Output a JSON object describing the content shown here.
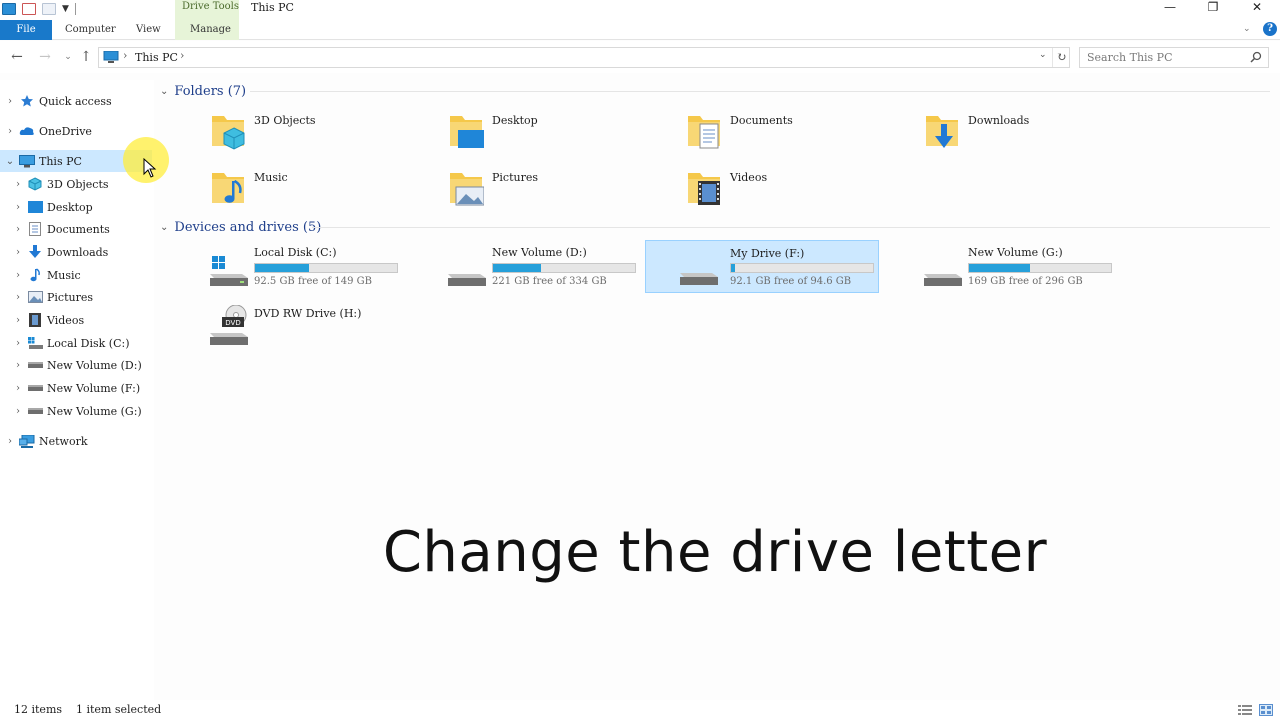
{
  "window": {
    "title": "This PC",
    "context_tab": "Drive Tools",
    "tabs": [
      "File",
      "Computer",
      "View",
      "Manage"
    ]
  },
  "nav": {
    "breadcrumb": "This PC",
    "search_placeholder": "Search This PC"
  },
  "sidebar": {
    "items": [
      {
        "label": "Quick access",
        "icon": "star-icon"
      },
      {
        "label": "OneDrive",
        "icon": "cloud-icon"
      },
      {
        "label": "This PC",
        "icon": "pc-icon"
      },
      {
        "label": "3D Objects",
        "icon": "cube-icon"
      },
      {
        "label": "Desktop",
        "icon": "desktop-icon"
      },
      {
        "label": "Documents",
        "icon": "document-icon"
      },
      {
        "label": "Downloads",
        "icon": "download-icon"
      },
      {
        "label": "Music",
        "icon": "music-icon"
      },
      {
        "label": "Pictures",
        "icon": "picture-icon"
      },
      {
        "label": "Videos",
        "icon": "video-icon"
      },
      {
        "label": "Local Disk (C:)",
        "icon": "drive-icon"
      },
      {
        "label": "New Volume (D:)",
        "icon": "drive-icon"
      },
      {
        "label": "New Volume (F:)",
        "icon": "drive-icon"
      },
      {
        "label": "New Volume (G:)",
        "icon": "drive-icon"
      },
      {
        "label": "Network",
        "icon": "network-icon"
      }
    ]
  },
  "main": {
    "folders_header": "Folders (7)",
    "folders": [
      {
        "label": "3D Objects",
        "icon": "cube-folder-icon"
      },
      {
        "label": "Desktop",
        "icon": "desktop-folder-icon"
      },
      {
        "label": "Documents",
        "icon": "documents-folder-icon"
      },
      {
        "label": "Downloads",
        "icon": "downloads-folder-icon"
      },
      {
        "label": "Music",
        "icon": "music-folder-icon"
      },
      {
        "label": "Pictures",
        "icon": "pictures-folder-icon"
      },
      {
        "label": "Videos",
        "icon": "videos-folder-icon"
      }
    ],
    "drives_header": "Devices and drives (5)",
    "drives": [
      {
        "name": "Local Disk (C:)",
        "free": "92.5 GB free of 149 GB",
        "used_fraction": 0.38
      },
      {
        "name": "New Volume (D:)",
        "free": "221 GB free of 334 GB",
        "used_fraction": 0.34
      },
      {
        "name": "My Drive (F:)",
        "free": "92.1 GB free of 94.6 GB",
        "used_fraction": 0.03
      },
      {
        "name": "New Volume (G:)",
        "free": "169 GB free of 296 GB",
        "used_fraction": 0.43
      },
      {
        "name": "DVD RW Drive (H:)",
        "free": "",
        "used_fraction": null
      }
    ]
  },
  "caption": "Change the drive letter",
  "status": {
    "items": "12 items",
    "selected": "1 item selected"
  },
  "colors": {
    "accent": "#1979ca",
    "selection": "#cce8ff",
    "usage_bar": "#26a0da",
    "group_header": "#1e3e8a"
  }
}
